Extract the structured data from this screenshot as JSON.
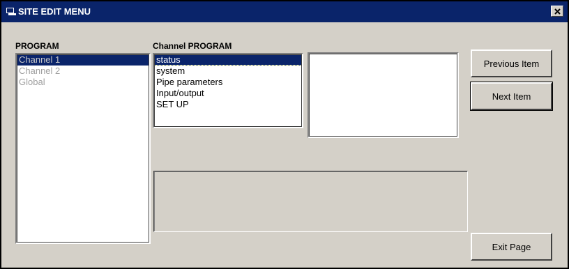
{
  "window": {
    "title": "SITE EDIT MENU",
    "close_label": "X"
  },
  "program": {
    "label": "PROGRAM",
    "items": [
      "Channel 1",
      "Channel 2",
      "Global"
    ],
    "selected_index": 0
  },
  "channel_program": {
    "label": "Channel PROGRAM",
    "items": [
      "status",
      "system",
      "Pipe parameters",
      "Input/output",
      "SET UP"
    ],
    "selected_index": 0
  },
  "buttons": {
    "previous_label": "Previous Item",
    "next_label": "Next Item",
    "exit_label": "Exit Page"
  },
  "colors": {
    "title_bar": "#0a246a",
    "window_bg": "#d4d0c8",
    "selection": "#0a246a"
  }
}
